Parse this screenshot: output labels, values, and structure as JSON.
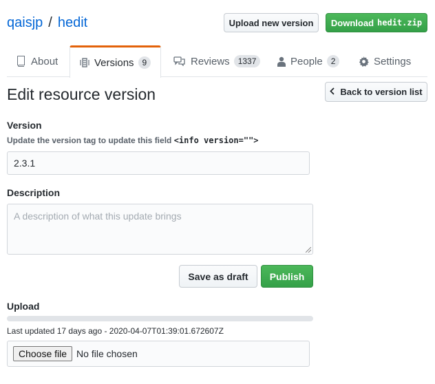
{
  "breadcrumb": {
    "owner": "qaisjp",
    "separator": "/",
    "resource": "hedit"
  },
  "header": {
    "upload_label": "Upload new version",
    "download_label": "Download",
    "download_file": "hedit.zip"
  },
  "tabs": [
    {
      "label": "About",
      "icon": "book-icon",
      "count": null
    },
    {
      "label": "Versions",
      "icon": "versions-icon",
      "count": "9",
      "selected": true
    },
    {
      "label": "Reviews",
      "icon": "comments-icon",
      "count": "1337"
    },
    {
      "label": "People",
      "icon": "person-icon",
      "count": "2"
    },
    {
      "label": "Settings",
      "icon": "gear-icon",
      "count": null
    }
  ],
  "main": {
    "title": "Edit resource version",
    "back_label": "Back to version list",
    "version": {
      "label": "Version",
      "note": "Update the version tag to update this field",
      "note_code": "<info version=\"\">",
      "value": "2.3.1"
    },
    "description": {
      "label": "Description",
      "placeholder": "A description of what this update brings"
    },
    "save_draft_label": "Save as draft",
    "publish_label": "Publish",
    "upload": {
      "label": "Upload",
      "progress": 0,
      "last_updated": "Last updated 17 days ago - 2020-04-07T01:39:01.672607Z",
      "choose_label": "Choose file",
      "file_status": "No file chosen"
    }
  },
  "colors": {
    "link": "#0366d6",
    "accent_tab": "#e36209",
    "primary_button": "#34a048"
  }
}
